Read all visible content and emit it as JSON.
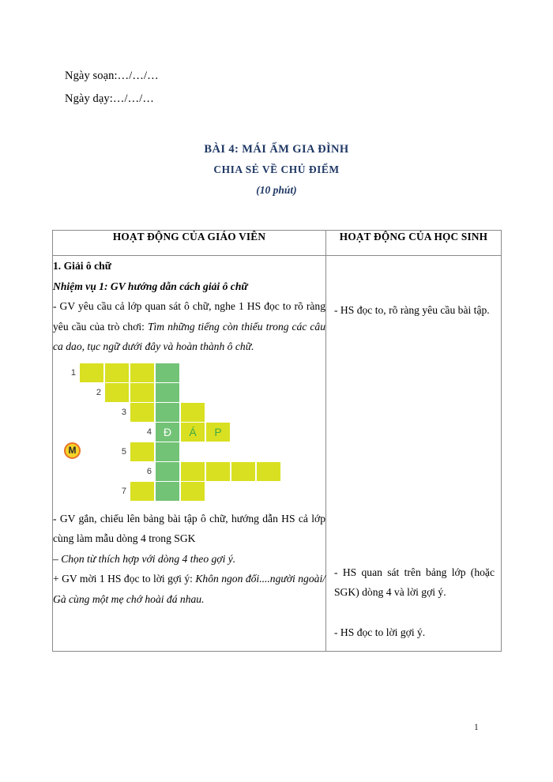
{
  "document": {
    "date_lines": [
      "Ngày soạn:…/…/…",
      "Ngày dạy:…/…/…"
    ],
    "title_main": "BÀI 4: MÁI ẤM GIA ĐÌNH",
    "title_sub": "CHIA SẺ VỀ CHỦ ĐIỂM",
    "title_time": "(10 phút)",
    "page_number": "1",
    "title_color": "#1F3864"
  },
  "table": {
    "headers": {
      "teacher": "HOẠT ĐỘNG CỦA GIÁO VIÊN",
      "student": "HOẠT ĐỘNG CỦA HỌC SINH"
    },
    "teacher_column": {
      "heading": "1. Giải ô chữ",
      "task_label": "Nhiệm vụ 1: GV hướng dẫn cách giải ô chữ",
      "para1_plain": "- GV yêu cầu cả lớp quan sát ô chữ, nghe 1 HS đọc to rõ ràng yêu cầu của trò chơi: ",
      "para1_italic": "Tìm những tiếng còn thiếu trong các câu ca dao, tục ngữ dưới đây và hoàn thành ô chữ.",
      "para2": "- GV gắn, chiếu lên bảng bài tập ô chữ, hướng dẫn HS cả lớp cùng làm mẫu dòng 4 trong SGK",
      "para3_italic": "– Chọn từ thích hợp với dòng 4 theo gợi ý.",
      "para4_plain": "+ GV mời 1 HS đọc to lời gợi ý: ",
      "para4_italic": "Khôn ngon đối....người ngoài/ Gà cùng một mẹ chớ hoài đá nhau."
    },
    "student_column": {
      "item1": "- HS đọc to, rõ ràng yêu cầu bài tập.",
      "item2": "- HS quan sát trên bảng lớp (hoặc SGK) dòng 4 và lời gợi ý.",
      "item3": "- HS đọc to lời gợi ý."
    }
  },
  "crossword": {
    "badge_label": "M",
    "colors": {
      "yellow": "#d9e021",
      "green": "#72c376",
      "badge_fill": "#f5d327",
      "badge_ring": "#e8732a",
      "letter_on_green": "#ffffff",
      "letter_on_yellow": "#3faa44"
    },
    "rows": [
      {
        "number": "1",
        "indent": 0,
        "cells": [
          {
            "color": "y",
            "letter": ""
          },
          {
            "color": "y",
            "letter": ""
          },
          {
            "color": "y",
            "letter": ""
          },
          {
            "color": "g",
            "letter": ""
          }
        ]
      },
      {
        "number": "2",
        "indent": 1,
        "cells": [
          {
            "color": "y",
            "letter": ""
          },
          {
            "color": "y",
            "letter": ""
          },
          {
            "color": "g",
            "letter": ""
          }
        ]
      },
      {
        "number": "3",
        "indent": 2,
        "cells": [
          {
            "color": "y",
            "letter": ""
          },
          {
            "color": "g",
            "letter": ""
          },
          {
            "color": "y",
            "letter": ""
          }
        ]
      },
      {
        "number": "4",
        "indent": 3,
        "cells": [
          {
            "color": "g",
            "letter": "Đ"
          },
          {
            "color": "y",
            "letter": "Á"
          },
          {
            "color": "y",
            "letter": "P"
          }
        ]
      },
      {
        "number": "5",
        "indent": 2,
        "cells": [
          {
            "color": "y",
            "letter": ""
          },
          {
            "color": "g",
            "letter": ""
          }
        ]
      },
      {
        "number": "6",
        "indent": 3,
        "cells": [
          {
            "color": "g",
            "letter": ""
          },
          {
            "color": "y",
            "letter": ""
          },
          {
            "color": "y",
            "letter": ""
          },
          {
            "color": "y",
            "letter": ""
          },
          {
            "color": "y",
            "letter": ""
          }
        ]
      },
      {
        "number": "7",
        "indent": 2,
        "cells": [
          {
            "color": "y",
            "letter": ""
          },
          {
            "color": "g",
            "letter": ""
          },
          {
            "color": "y",
            "letter": ""
          }
        ]
      }
    ]
  }
}
